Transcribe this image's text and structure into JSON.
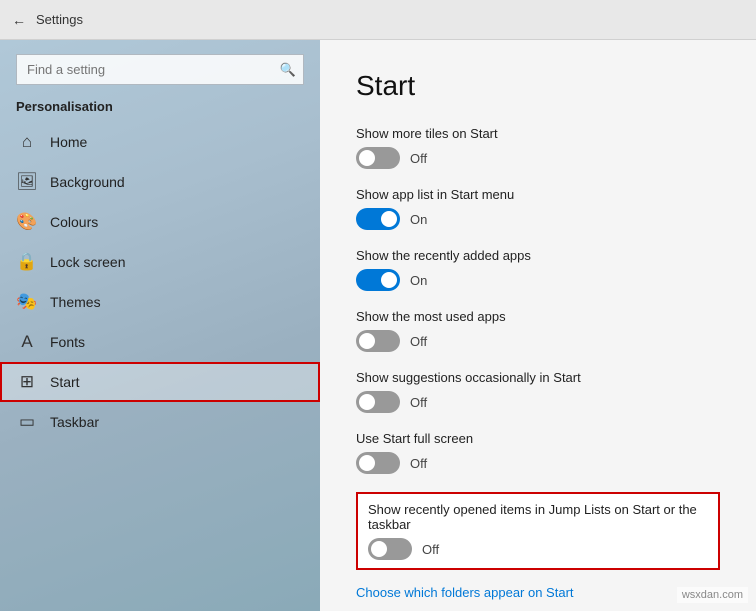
{
  "titleBar": {
    "back_label": "←",
    "title": "Settings"
  },
  "sidebar": {
    "search_placeholder": "Find a setting",
    "section_label": "Personalisation",
    "items": [
      {
        "id": "home",
        "label": "Home",
        "icon": "⌂"
      },
      {
        "id": "background",
        "label": "Background",
        "icon": "🖼"
      },
      {
        "id": "colours",
        "label": "Colours",
        "icon": "🎨"
      },
      {
        "id": "lock-screen",
        "label": "Lock screen",
        "icon": "🔒"
      },
      {
        "id": "themes",
        "label": "Themes",
        "icon": "🎭"
      },
      {
        "id": "fonts",
        "label": "Fonts",
        "icon": "A"
      },
      {
        "id": "start",
        "label": "Start",
        "icon": "⊞",
        "active": true,
        "highlighted": true
      },
      {
        "id": "taskbar",
        "label": "Taskbar",
        "icon": "▭"
      }
    ]
  },
  "content": {
    "page_title": "Start",
    "settings": [
      {
        "id": "show-more-tiles",
        "label": "Show more tiles on Start",
        "state": "off",
        "state_label": "Off"
      },
      {
        "id": "show-app-list",
        "label": "Show app list in Start menu",
        "state": "on",
        "state_label": "On"
      },
      {
        "id": "show-recently-added",
        "label": "Show the recently added apps",
        "state": "on",
        "state_label": "On"
      },
      {
        "id": "show-most-used",
        "label": "Show the most used apps",
        "state": "off",
        "state_label": "Off"
      },
      {
        "id": "show-suggestions",
        "label": "Show suggestions occasionally in Start",
        "state": "off",
        "state_label": "Off"
      },
      {
        "id": "full-screen",
        "label": "Use Start full screen",
        "state": "off",
        "state_label": "Off"
      },
      {
        "id": "recently-opened",
        "label": "Show recently opened items in Jump Lists on Start or the taskbar",
        "state": "off",
        "state_label": "Off",
        "highlighted": true
      }
    ],
    "link_text": "Choose which folders appear on Start"
  }
}
